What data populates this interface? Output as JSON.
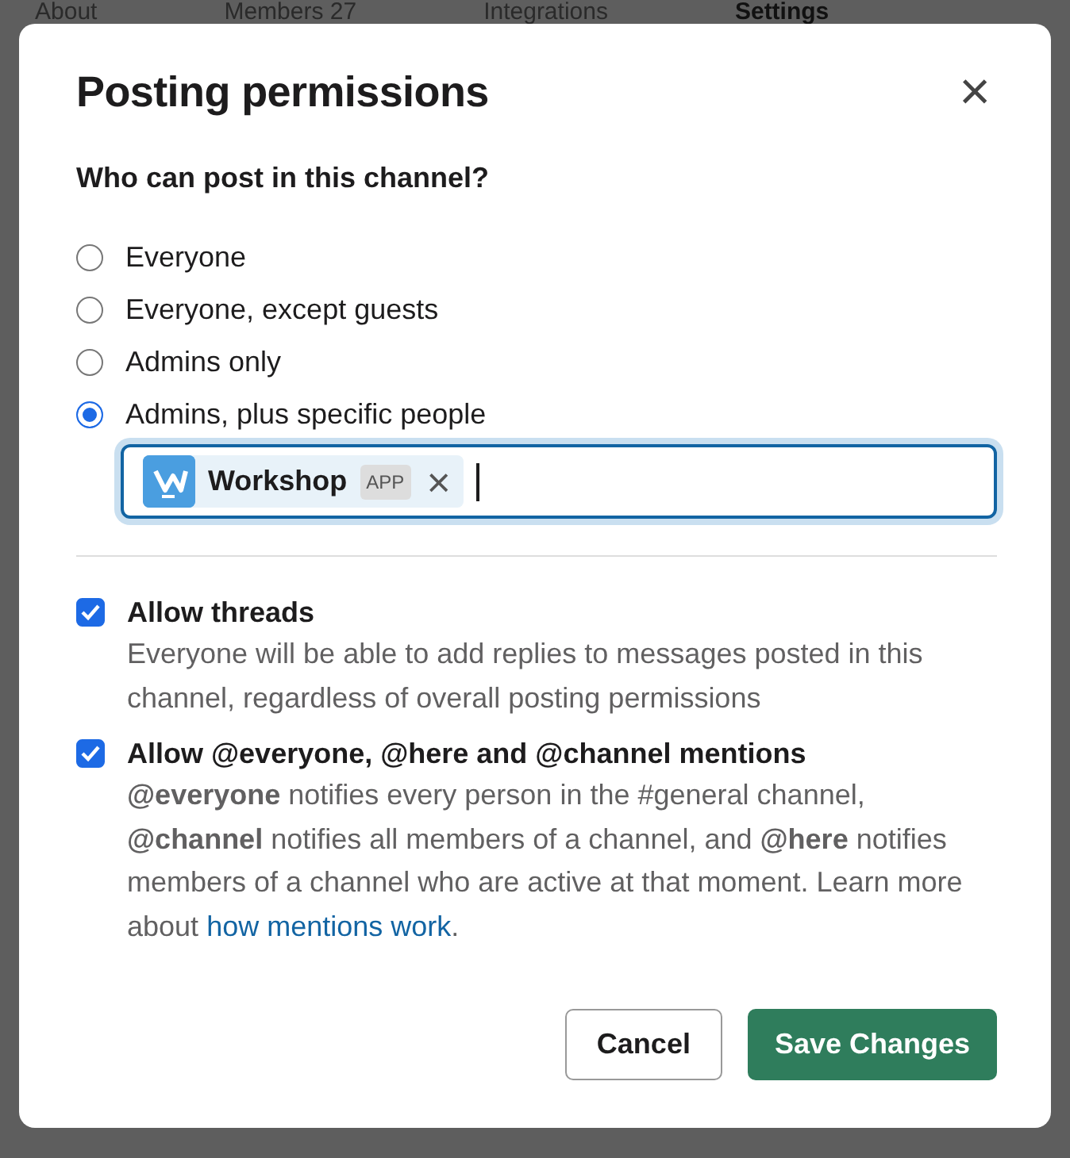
{
  "background_tabs": [
    {
      "label": "About",
      "selected": false
    },
    {
      "label": "Members 27",
      "selected": false
    },
    {
      "label": "Integrations",
      "selected": false
    },
    {
      "label": "Settings",
      "selected": true
    }
  ],
  "dialog": {
    "title": "Posting permissions",
    "close": "×",
    "question": "Who can post in this channel?",
    "options": [
      {
        "label": "Everyone",
        "selected": false
      },
      {
        "label": "Everyone, except guests",
        "selected": false
      },
      {
        "label": "Admins only",
        "selected": false
      },
      {
        "label": "Admins, plus specific people",
        "selected": true
      }
    ],
    "people_field": {
      "tokens": [
        {
          "name": "Workshop",
          "badge": "APP",
          "remove": "×"
        }
      ]
    },
    "settings": [
      {
        "label": "Allow threads",
        "checked": true,
        "description": "Everyone will be able to add replies to messages posted in this channel, regardless of overall posting permissions"
      },
      {
        "label": "Allow @everyone, @here and @channel mentions",
        "checked": true,
        "description": "**@everyone** notifies every person in the #general channel, **@channel** notifies all members of a channel, and **@here** notifies members of a channel who are active at that moment. Learn more about",
        "link": "how mentions work",
        "after_link": "."
      }
    ],
    "buttons": [
      {
        "label": "Cancel",
        "kind": "secondary"
      },
      {
        "label": "Save Changes",
        "kind": "primary"
      }
    ]
  }
}
